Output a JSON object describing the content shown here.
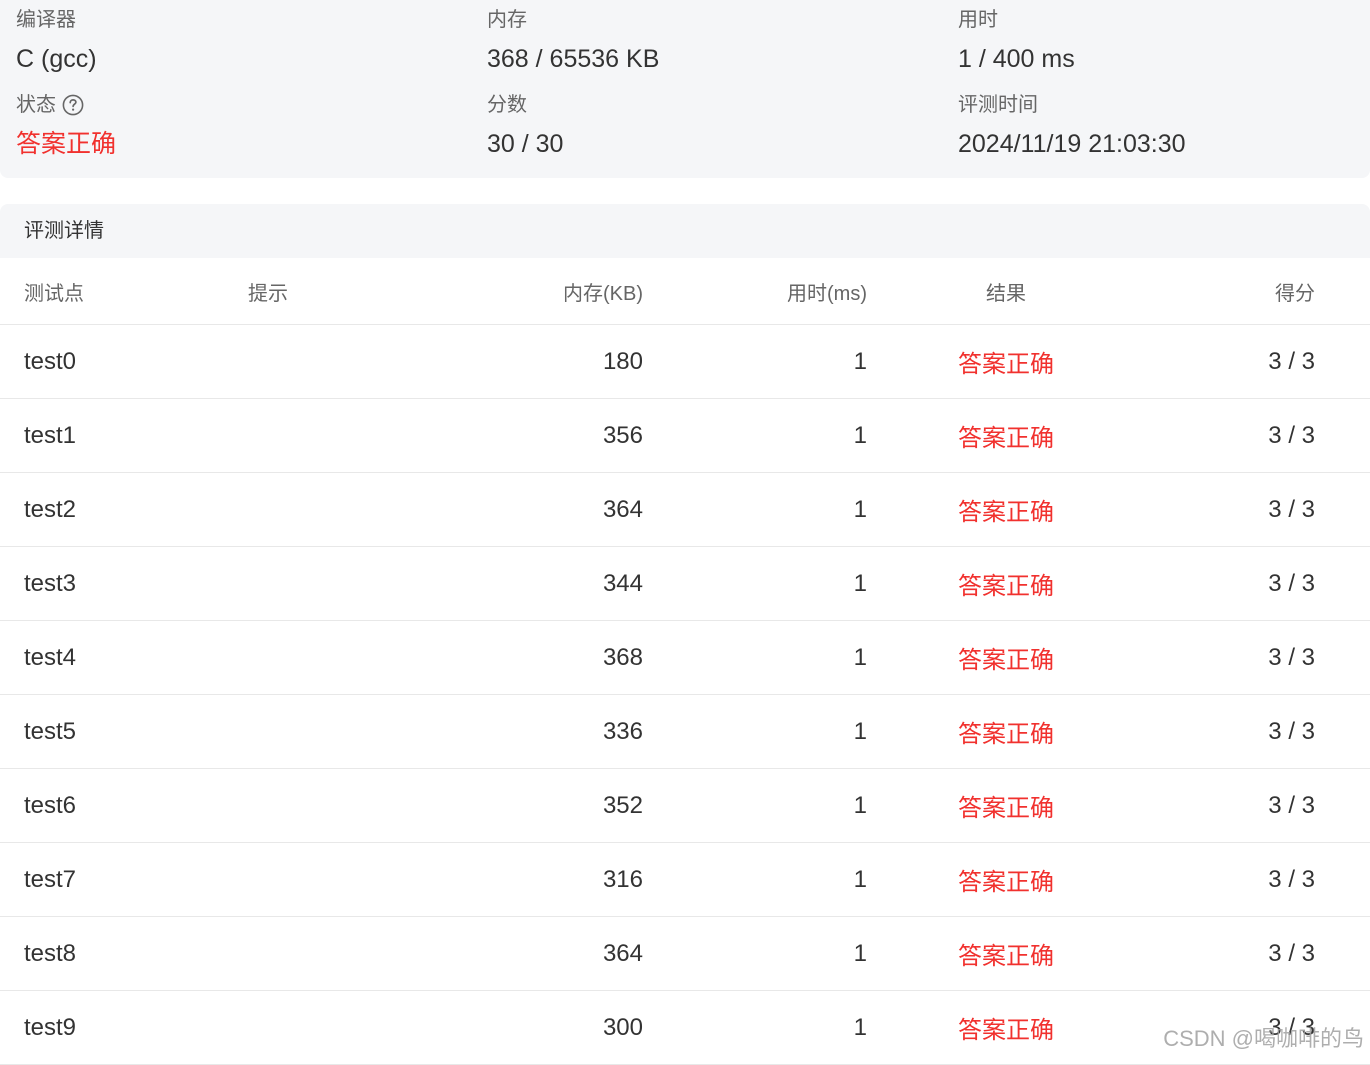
{
  "summary": {
    "compiler_label": "编译器",
    "compiler_value": "C (gcc)",
    "memory_label": "内存",
    "memory_value": "368 / 65536 KB",
    "time_label": "用时",
    "time_value": "1 / 400 ms",
    "status_label": "状态",
    "status_value": "答案正确",
    "score_label": "分数",
    "score_value": "30 / 30",
    "judge_time_label": "评测时间",
    "judge_time_value": "2024/11/19 21:03:30"
  },
  "details": {
    "title": "评测详情",
    "columns": {
      "case": "测试点",
      "hint": "提示",
      "memory": "内存(KB)",
      "time": "用时(ms)",
      "result": "结果",
      "score": "得分"
    },
    "rows": [
      {
        "case": "test0",
        "hint": "",
        "memory": "180",
        "time": "1",
        "result": "答案正确",
        "score": "3 / 3"
      },
      {
        "case": "test1",
        "hint": "",
        "memory": "356",
        "time": "1",
        "result": "答案正确",
        "score": "3 / 3"
      },
      {
        "case": "test2",
        "hint": "",
        "memory": "364",
        "time": "1",
        "result": "答案正确",
        "score": "3 / 3"
      },
      {
        "case": "test3",
        "hint": "",
        "memory": "344",
        "time": "1",
        "result": "答案正确",
        "score": "3 / 3"
      },
      {
        "case": "test4",
        "hint": "",
        "memory": "368",
        "time": "1",
        "result": "答案正确",
        "score": "3 / 3"
      },
      {
        "case": "test5",
        "hint": "",
        "memory": "336",
        "time": "1",
        "result": "答案正确",
        "score": "3 / 3"
      },
      {
        "case": "test6",
        "hint": "",
        "memory": "352",
        "time": "1",
        "result": "答案正确",
        "score": "3 / 3"
      },
      {
        "case": "test7",
        "hint": "",
        "memory": "316",
        "time": "1",
        "result": "答案正确",
        "score": "3 / 3"
      },
      {
        "case": "test8",
        "hint": "",
        "memory": "364",
        "time": "1",
        "result": "答案正确",
        "score": "3 / 3"
      },
      {
        "case": "test9",
        "hint": "",
        "memory": "300",
        "time": "1",
        "result": "答案正确",
        "score": "3 / 3"
      }
    ]
  },
  "watermark": "CSDN @喝咖啡的鸟",
  "colors": {
    "accent_red": "#f1312e",
    "panel_bg": "#f5f6f8",
    "border": "#e8e8e8"
  },
  "icons": {
    "status_help": "question-circle-icon"
  }
}
